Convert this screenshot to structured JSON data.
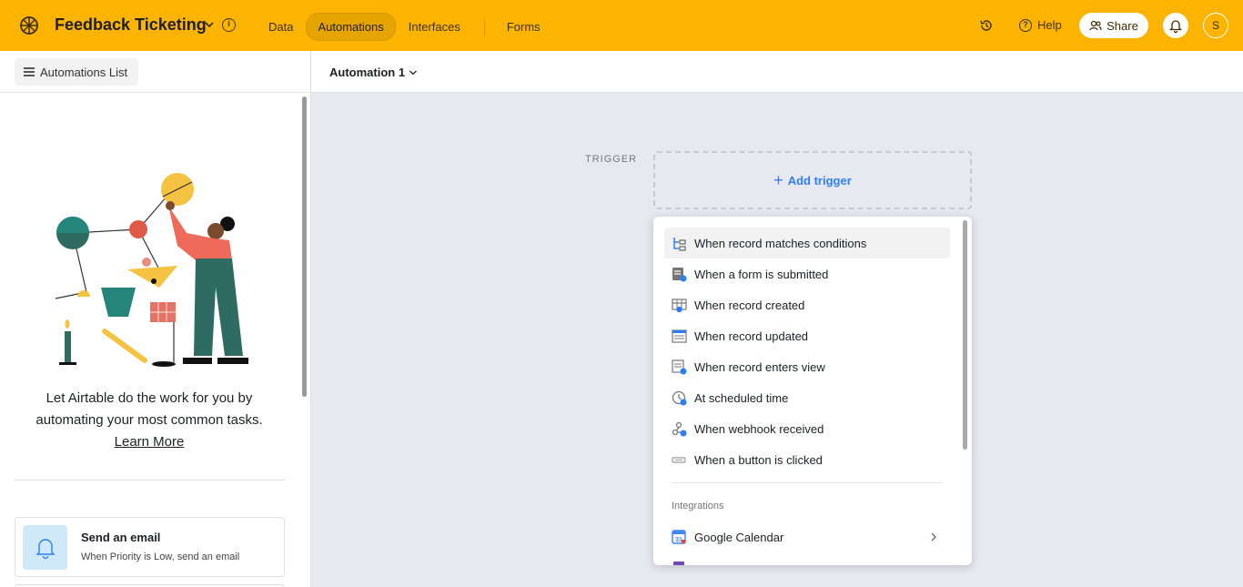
{
  "app": {
    "base_title": "Feedback Ticketing",
    "nav_tabs": [
      "Data",
      "Automations",
      "Interfaces",
      "Forms"
    ],
    "active_tab": "Automations",
    "help_label": "Help",
    "share_label": "Share",
    "avatar_initial": "S",
    "accent_color": "#fcb400"
  },
  "sidebar": {
    "list_button_label": "Automations List",
    "promo_text": "Let Airtable do the work for you by automating your most common tasks.",
    "learn_more": "Learn More",
    "template": {
      "title": "Send an email",
      "subtitle": "When Priority is Low, send an email"
    }
  },
  "main": {
    "automation_name": "Automation 1",
    "trigger_label": "TRIGGER",
    "add_trigger_label": "Add trigger"
  },
  "trigger_menu": {
    "items": [
      {
        "label": "When record matches conditions",
        "icon": "conditions-icon"
      },
      {
        "label": "When a form is submitted",
        "icon": "form-icon"
      },
      {
        "label": "When record created",
        "icon": "record-created-icon"
      },
      {
        "label": "When record updated",
        "icon": "record-updated-icon"
      },
      {
        "label": "When record enters view",
        "icon": "view-icon"
      },
      {
        "label": "At scheduled time",
        "icon": "clock-icon"
      },
      {
        "label": "When webhook received",
        "icon": "webhook-icon"
      },
      {
        "label": "When a button is clicked",
        "icon": "button-icon"
      }
    ],
    "integrations_label": "Integrations",
    "integrations": [
      {
        "label": "Google Calendar",
        "icon": "google-calendar-icon"
      }
    ]
  }
}
